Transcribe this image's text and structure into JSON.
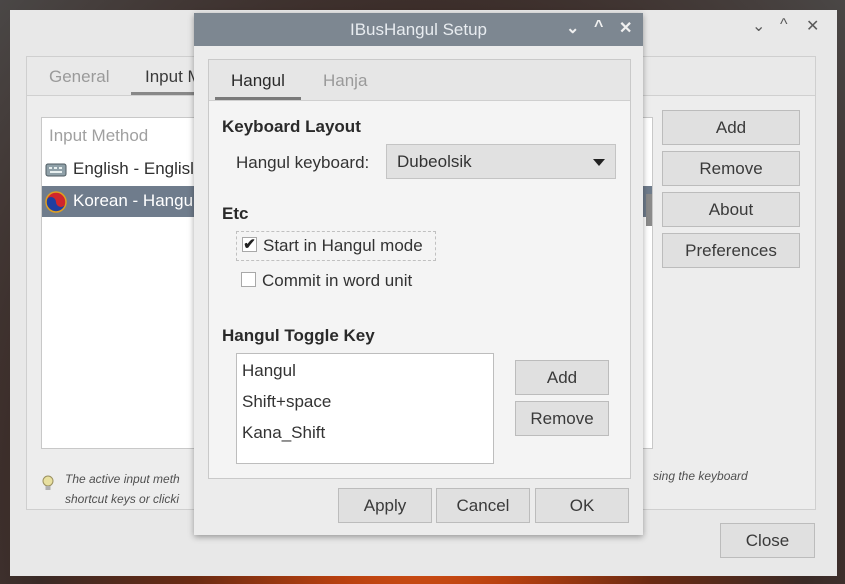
{
  "bg_window": {
    "controls": {
      "minimize": "⌄",
      "maximize": "^",
      "close": "✕"
    },
    "tabs": [
      {
        "label": "General"
      },
      {
        "label": "Input M"
      }
    ],
    "list": {
      "header": "Input Method",
      "rows": [
        {
          "label": "English - Englisl",
          "icon": "keyboard-icon"
        },
        {
          "label": "Korean - Hangu",
          "icon": "taegeuk-icon"
        }
      ]
    },
    "buttons": {
      "add": "Add",
      "remove": "Remove",
      "about": "About",
      "preferences": "Preferences",
      "close": "Close"
    },
    "hint": {
      "line1": "The active input meth",
      "line2": "shortcut keys or clicki",
      "line1_right": "sing the keyboard"
    }
  },
  "dialog": {
    "title": "IBusHangul Setup",
    "controls": {
      "minimize": "⌄",
      "maximize": "^",
      "close": "✕"
    },
    "tabs": [
      {
        "label": "Hangul"
      },
      {
        "label": "Hanja"
      }
    ],
    "keyboard_layout": {
      "heading": "Keyboard Layout",
      "label": "Hangul keyboard:",
      "value": "Dubeolsik"
    },
    "etc": {
      "heading": "Etc",
      "start_in_hangul": {
        "label": "Start in Hangul mode",
        "checked": true
      },
      "commit_word_unit": {
        "label": "Commit in word unit",
        "checked": false
      }
    },
    "toggle_key": {
      "heading": "Hangul Toggle Key",
      "items": [
        "Hangul",
        "Shift+space",
        "Kana_Shift"
      ],
      "add": "Add",
      "remove": "Remove"
    },
    "footer": {
      "apply": "Apply",
      "cancel": "Cancel",
      "ok": "OK"
    }
  }
}
